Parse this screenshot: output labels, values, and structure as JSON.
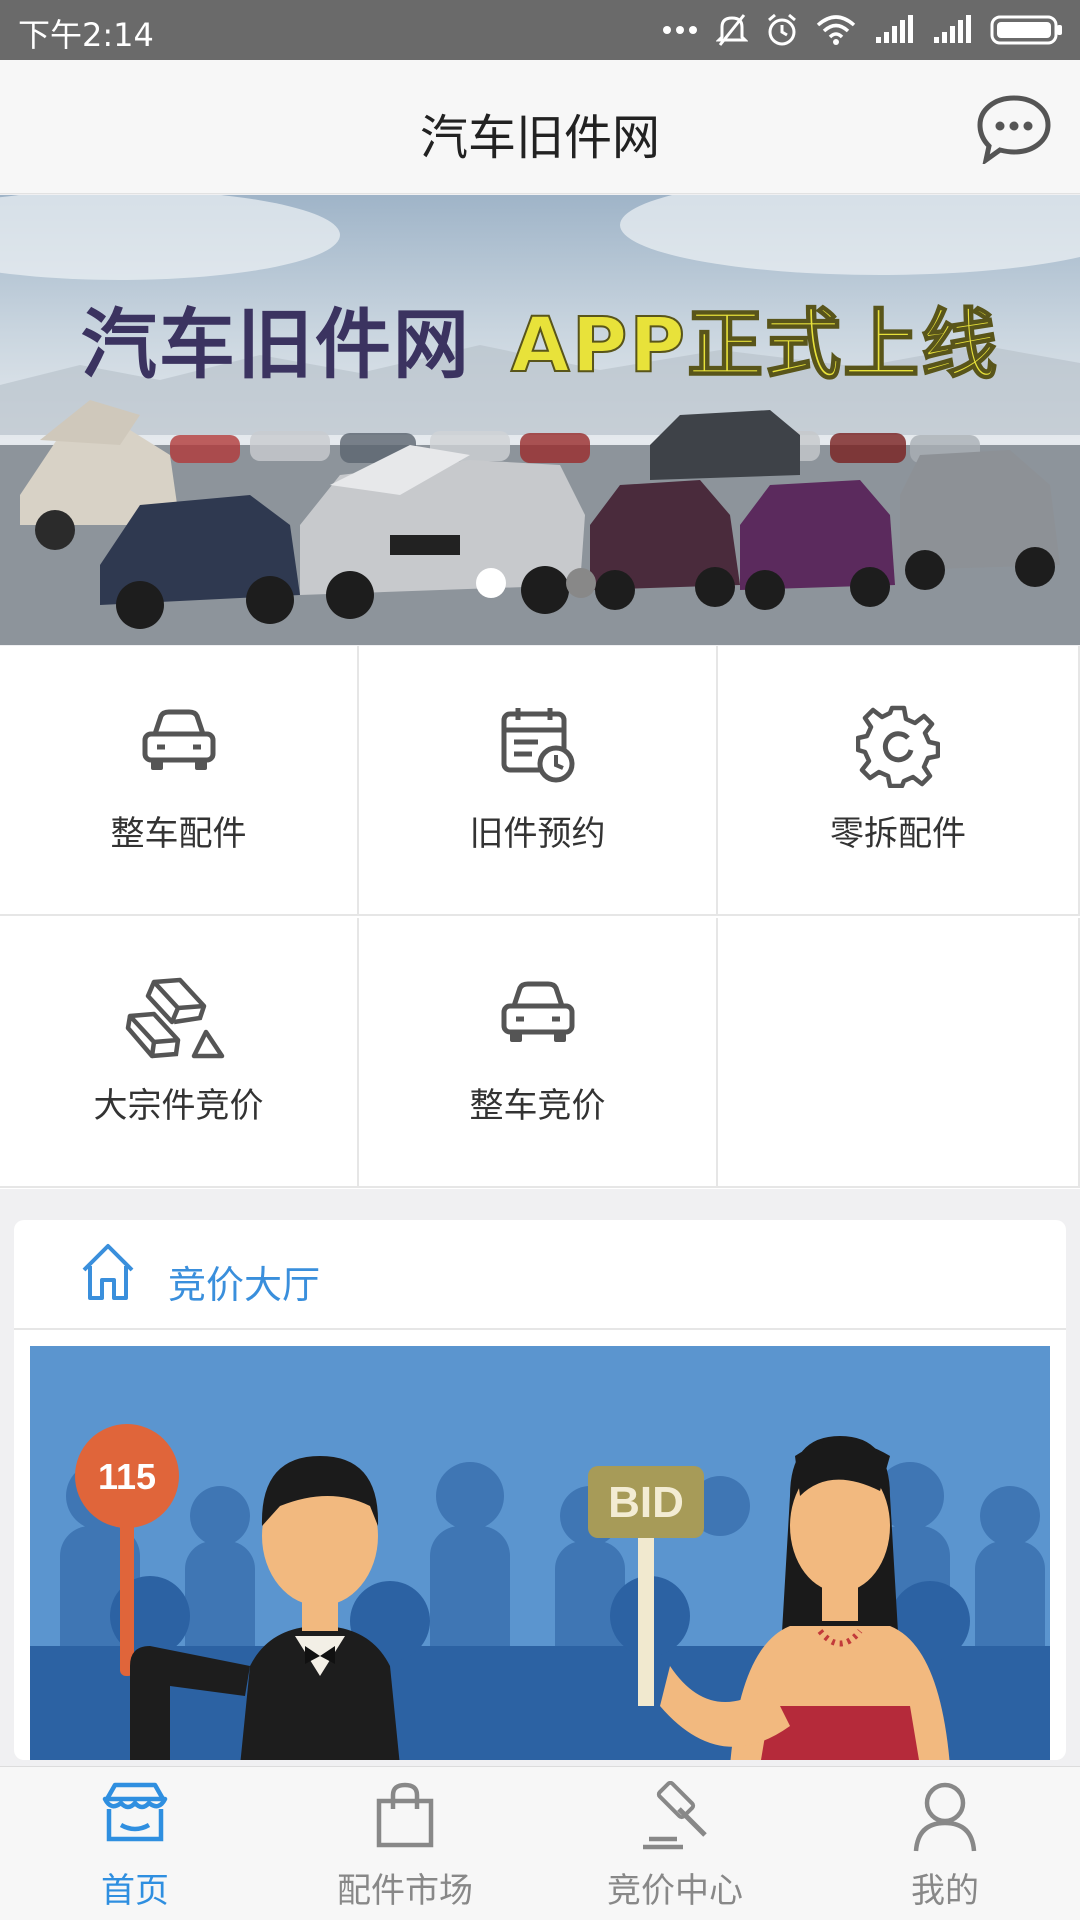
{
  "status_bar": {
    "time": "下午2:14"
  },
  "header": {
    "title": "汽车旧件网",
    "chat_icon": "chat-bubble-icon"
  },
  "banner": {
    "headline_part1": "汽车旧件网",
    "headline_part2": "APP正式上线",
    "active_slide": 1,
    "slide_count": 2
  },
  "grid": {
    "items": [
      {
        "label": "整车配件",
        "icon": "car-icon"
      },
      {
        "label": "旧件预约",
        "icon": "calendar-clock-icon"
      },
      {
        "label": "零拆配件",
        "icon": "gear-icon"
      },
      {
        "label": "大宗件竞价",
        "icon": "gold-bars-icon"
      },
      {
        "label": "整车竞价",
        "icon": "car-icon"
      }
    ]
  },
  "auction": {
    "title": "竞价大厅",
    "paddle_number": "115",
    "sign_text": "BID"
  },
  "tabbar": {
    "items": [
      {
        "label": "首页",
        "icon": "store-icon",
        "active": true
      },
      {
        "label": "配件市场",
        "icon": "shopping-bag-icon",
        "active": false
      },
      {
        "label": "竞价中心",
        "icon": "gavel-icon",
        "active": false
      },
      {
        "label": "我的",
        "icon": "user-icon",
        "active": false
      }
    ]
  },
  "colors": {
    "accent": "#2f8fe0",
    "status_bar": "#6a6a6a",
    "banner_yellow": "#e8e23a"
  }
}
